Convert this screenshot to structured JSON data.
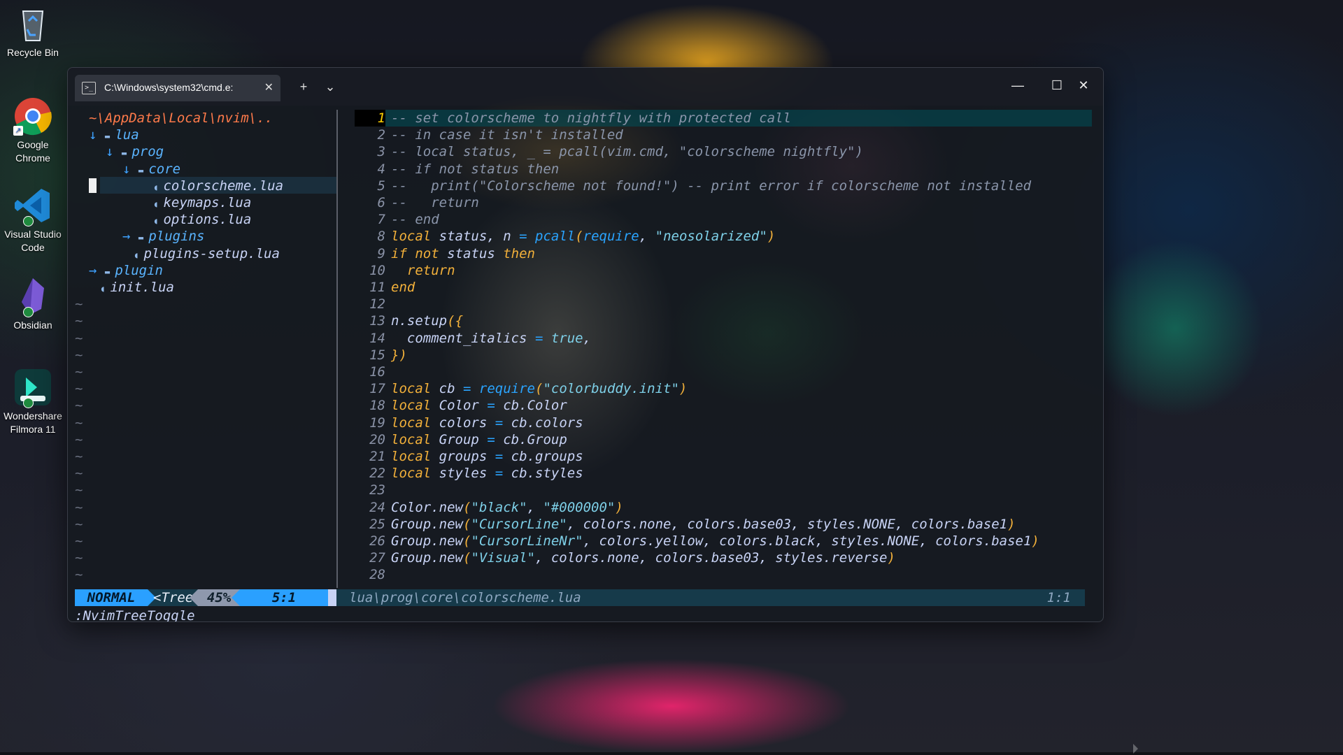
{
  "desktop": {
    "icons": [
      {
        "label": "Recycle Bin"
      },
      {
        "label": "Google Chrome"
      },
      {
        "label": "Visual Studio Code"
      },
      {
        "label": "Obsidian"
      },
      {
        "label": "Wondershare Filmora 11"
      }
    ]
  },
  "window": {
    "tab_title": "C:\\Windows\\system32\\cmd.e:",
    "tab_close": "✕",
    "new_tab": "+",
    "dropdown": "⌄",
    "minimize": "—",
    "maximize": "☐",
    "close": "✕"
  },
  "tree": {
    "root": "~\\AppData\\Local\\nvim\\..",
    "items": [
      {
        "arrow": "🡣",
        "icon": "▪",
        "label": "lua",
        "type": "dir"
      },
      {
        "arrow": "🡣",
        "icon": "▪",
        "label": "prog",
        "type": "dir"
      },
      {
        "arrow": "🡣",
        "icon": "▪",
        "label": "core",
        "type": "dir"
      },
      {
        "arrow": "",
        "icon": "☾",
        "label": "colorscheme.lua",
        "type": "file"
      },
      {
        "arrow": "",
        "icon": "☾",
        "label": "keymaps.lua",
        "type": "file"
      },
      {
        "arrow": "",
        "icon": "☾",
        "label": "options.lua",
        "type": "file"
      },
      {
        "arrow": "🡢",
        "icon": "▪",
        "label": "plugins",
        "type": "dir"
      },
      {
        "arrow": "",
        "icon": "☾",
        "label": "plugins-setup.lua",
        "type": "file"
      },
      {
        "arrow": "🡢",
        "icon": "▪",
        "label": "plugin",
        "type": "dir"
      },
      {
        "arrow": "",
        "icon": "☾",
        "label": "init.lua",
        "type": "file"
      }
    ],
    "tilde": "~",
    "tilde_count": 17
  },
  "editor": {
    "lines": [
      "-- set colorscheme to nightfly with protected call",
      "-- in case it isn't installed",
      "-- local status, _ = pcall(vim.cmd, \"colorscheme nightfly\")",
      "-- if not status then",
      "--   print(\"Colorscheme not found!\") -- print error if colorscheme not installed",
      "--   return",
      "-- end",
      "local status, n = pcall(require, \"neosolarized\")",
      "if not status then",
      "  return",
      "end",
      "",
      "n.setup({",
      "  comment_italics = true,",
      "})",
      "",
      "local cb = require(\"colorbuddy.init\")",
      "local Color = cb.Color",
      "local colors = cb.colors",
      "local Group = cb.Group",
      "local groups = cb.groups",
      "local styles = cb.styles",
      "",
      "Color.new(\"black\", \"#000000\")",
      "Group.new(\"CursorLine\", colors.none, colors.base03, styles.NONE, colors.base1)",
      "Group.new(\"CursorLineNr\", colors.yellow, colors.black, styles.NONE, colors.base1)",
      "Group.new(\"Visual\", colors.none, colors.base03, styles.reverse)",
      ""
    ],
    "current_line": 1
  },
  "statusline": {
    "mode": "NORMAL",
    "tree": "<Tree",
    "percent": "45%",
    "position": "5:1",
    "file": "lua\\prog\\core\\colorscheme.lua",
    "rowcol": "1:1"
  },
  "cmdline": ":NvimTreeToggle",
  "colors": {
    "accent": "#2aa0ff",
    "keyword": "#f2b03a",
    "string": "#7ed0e8",
    "comment": "#8a95aa",
    "tree_root": "#ff7a4a"
  }
}
